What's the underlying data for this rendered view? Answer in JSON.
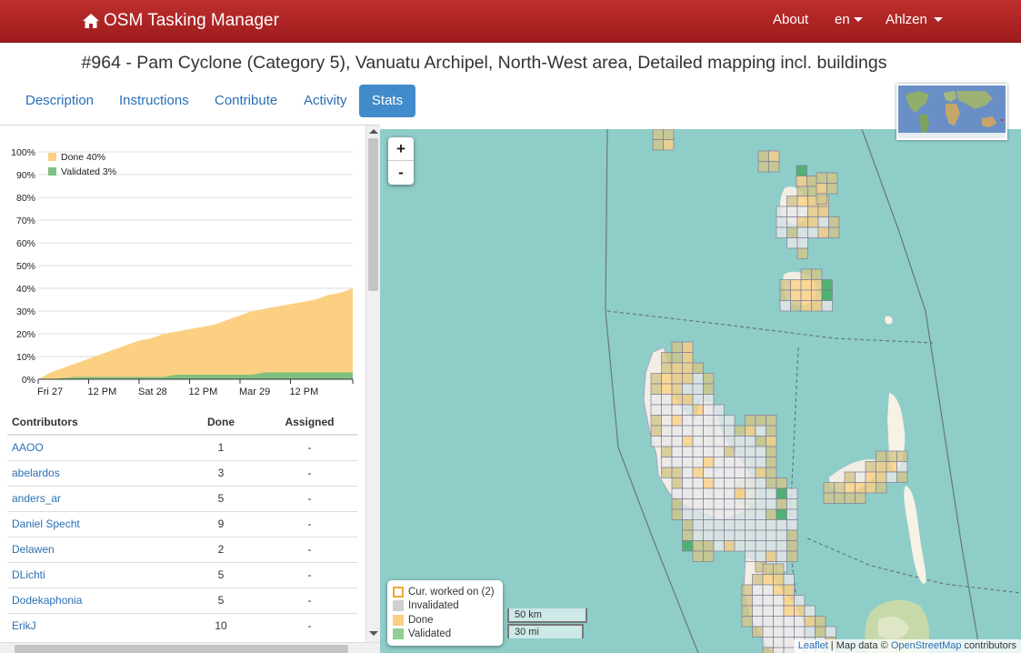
{
  "navbar": {
    "brand": "OSM Tasking Manager",
    "about": "About",
    "language": "en",
    "user": "Ahlzen"
  },
  "project": {
    "title": "#964 - Pam Cyclone (Category 5), Vanuatu Archipel, North-West area, Detailed mapping incl. buildings"
  },
  "tabs": [
    {
      "label": "Description",
      "active": false
    },
    {
      "label": "Instructions",
      "active": false
    },
    {
      "label": "Contribute",
      "active": false
    },
    {
      "label": "Activity",
      "active": false
    },
    {
      "label": "Stats",
      "active": true
    }
  ],
  "chart_data": {
    "type": "area",
    "yticks": [
      "0%",
      "10%",
      "20%",
      "30%",
      "40%",
      "50%",
      "60%",
      "70%",
      "80%",
      "90%",
      "100%"
    ],
    "ylim": [
      0,
      100
    ],
    "xticks": [
      "Fri 27",
      "12 PM",
      "Sat 28",
      "12 PM",
      "Mar 29",
      "12 PM"
    ],
    "legend_position": "top-left",
    "series": [
      {
        "name": "Done 40%",
        "color": "#fbd083",
        "values": [
          0,
          3,
          5,
          7,
          9,
          11,
          13,
          15,
          17,
          18,
          20,
          21,
          22,
          23,
          24,
          26,
          28,
          30,
          31,
          32,
          33,
          34,
          35,
          37,
          38,
          40
        ]
      },
      {
        "name": "Validated 3%",
        "color": "#7fbf7f",
        "values": [
          0,
          0,
          0.5,
          1,
          1,
          1,
          1,
          1,
          1,
          1,
          1,
          2,
          2,
          2,
          2,
          2,
          2,
          2,
          3,
          3,
          3,
          3,
          3,
          3,
          3,
          3
        ]
      }
    ]
  },
  "contributors": {
    "headers": {
      "name": "Contributors",
      "done": "Done",
      "assigned": "Assigned"
    },
    "rows": [
      {
        "name": "AAOO",
        "done": "1",
        "assigned": "-"
      },
      {
        "name": "abelardos",
        "done": "3",
        "assigned": "-"
      },
      {
        "name": "anders_ar",
        "done": "5",
        "assigned": "-"
      },
      {
        "name": "Daniel Specht",
        "done": "9",
        "assigned": "-"
      },
      {
        "name": "Delawen",
        "done": "2",
        "assigned": "-"
      },
      {
        "name": "DLichti",
        "done": "5",
        "assigned": "-"
      },
      {
        "name": "Dodekaphonia",
        "done": "5",
        "assigned": "-"
      },
      {
        "name": "ErikJ",
        "done": "10",
        "assigned": "-"
      }
    ]
  },
  "map": {
    "zoom_in": "+",
    "zoom_out": "-",
    "legend": [
      {
        "label": "Cur. worked on (2)",
        "color": "#ffffff",
        "border": "#f0a830"
      },
      {
        "label": "Invalidated",
        "color": "#cfcfcf",
        "border": "#cfcfcf"
      },
      {
        "label": "Done",
        "color": "#fbd083",
        "border": "#fbd083"
      },
      {
        "label": "Validated",
        "color": "#8fcf8f",
        "border": "#8fcf8f"
      }
    ],
    "scale_km": "50 km",
    "scale_mi": "30 mi",
    "attribution": {
      "leaflet": "Leaflet",
      "mapdata": " | Map data © ",
      "osm": "OpenStreetMap",
      "contrib": " contributors"
    },
    "colors": {
      "sea": "#8fcdc9",
      "land": "#f2eee4",
      "vegetation": "#c7d9a8"
    }
  }
}
